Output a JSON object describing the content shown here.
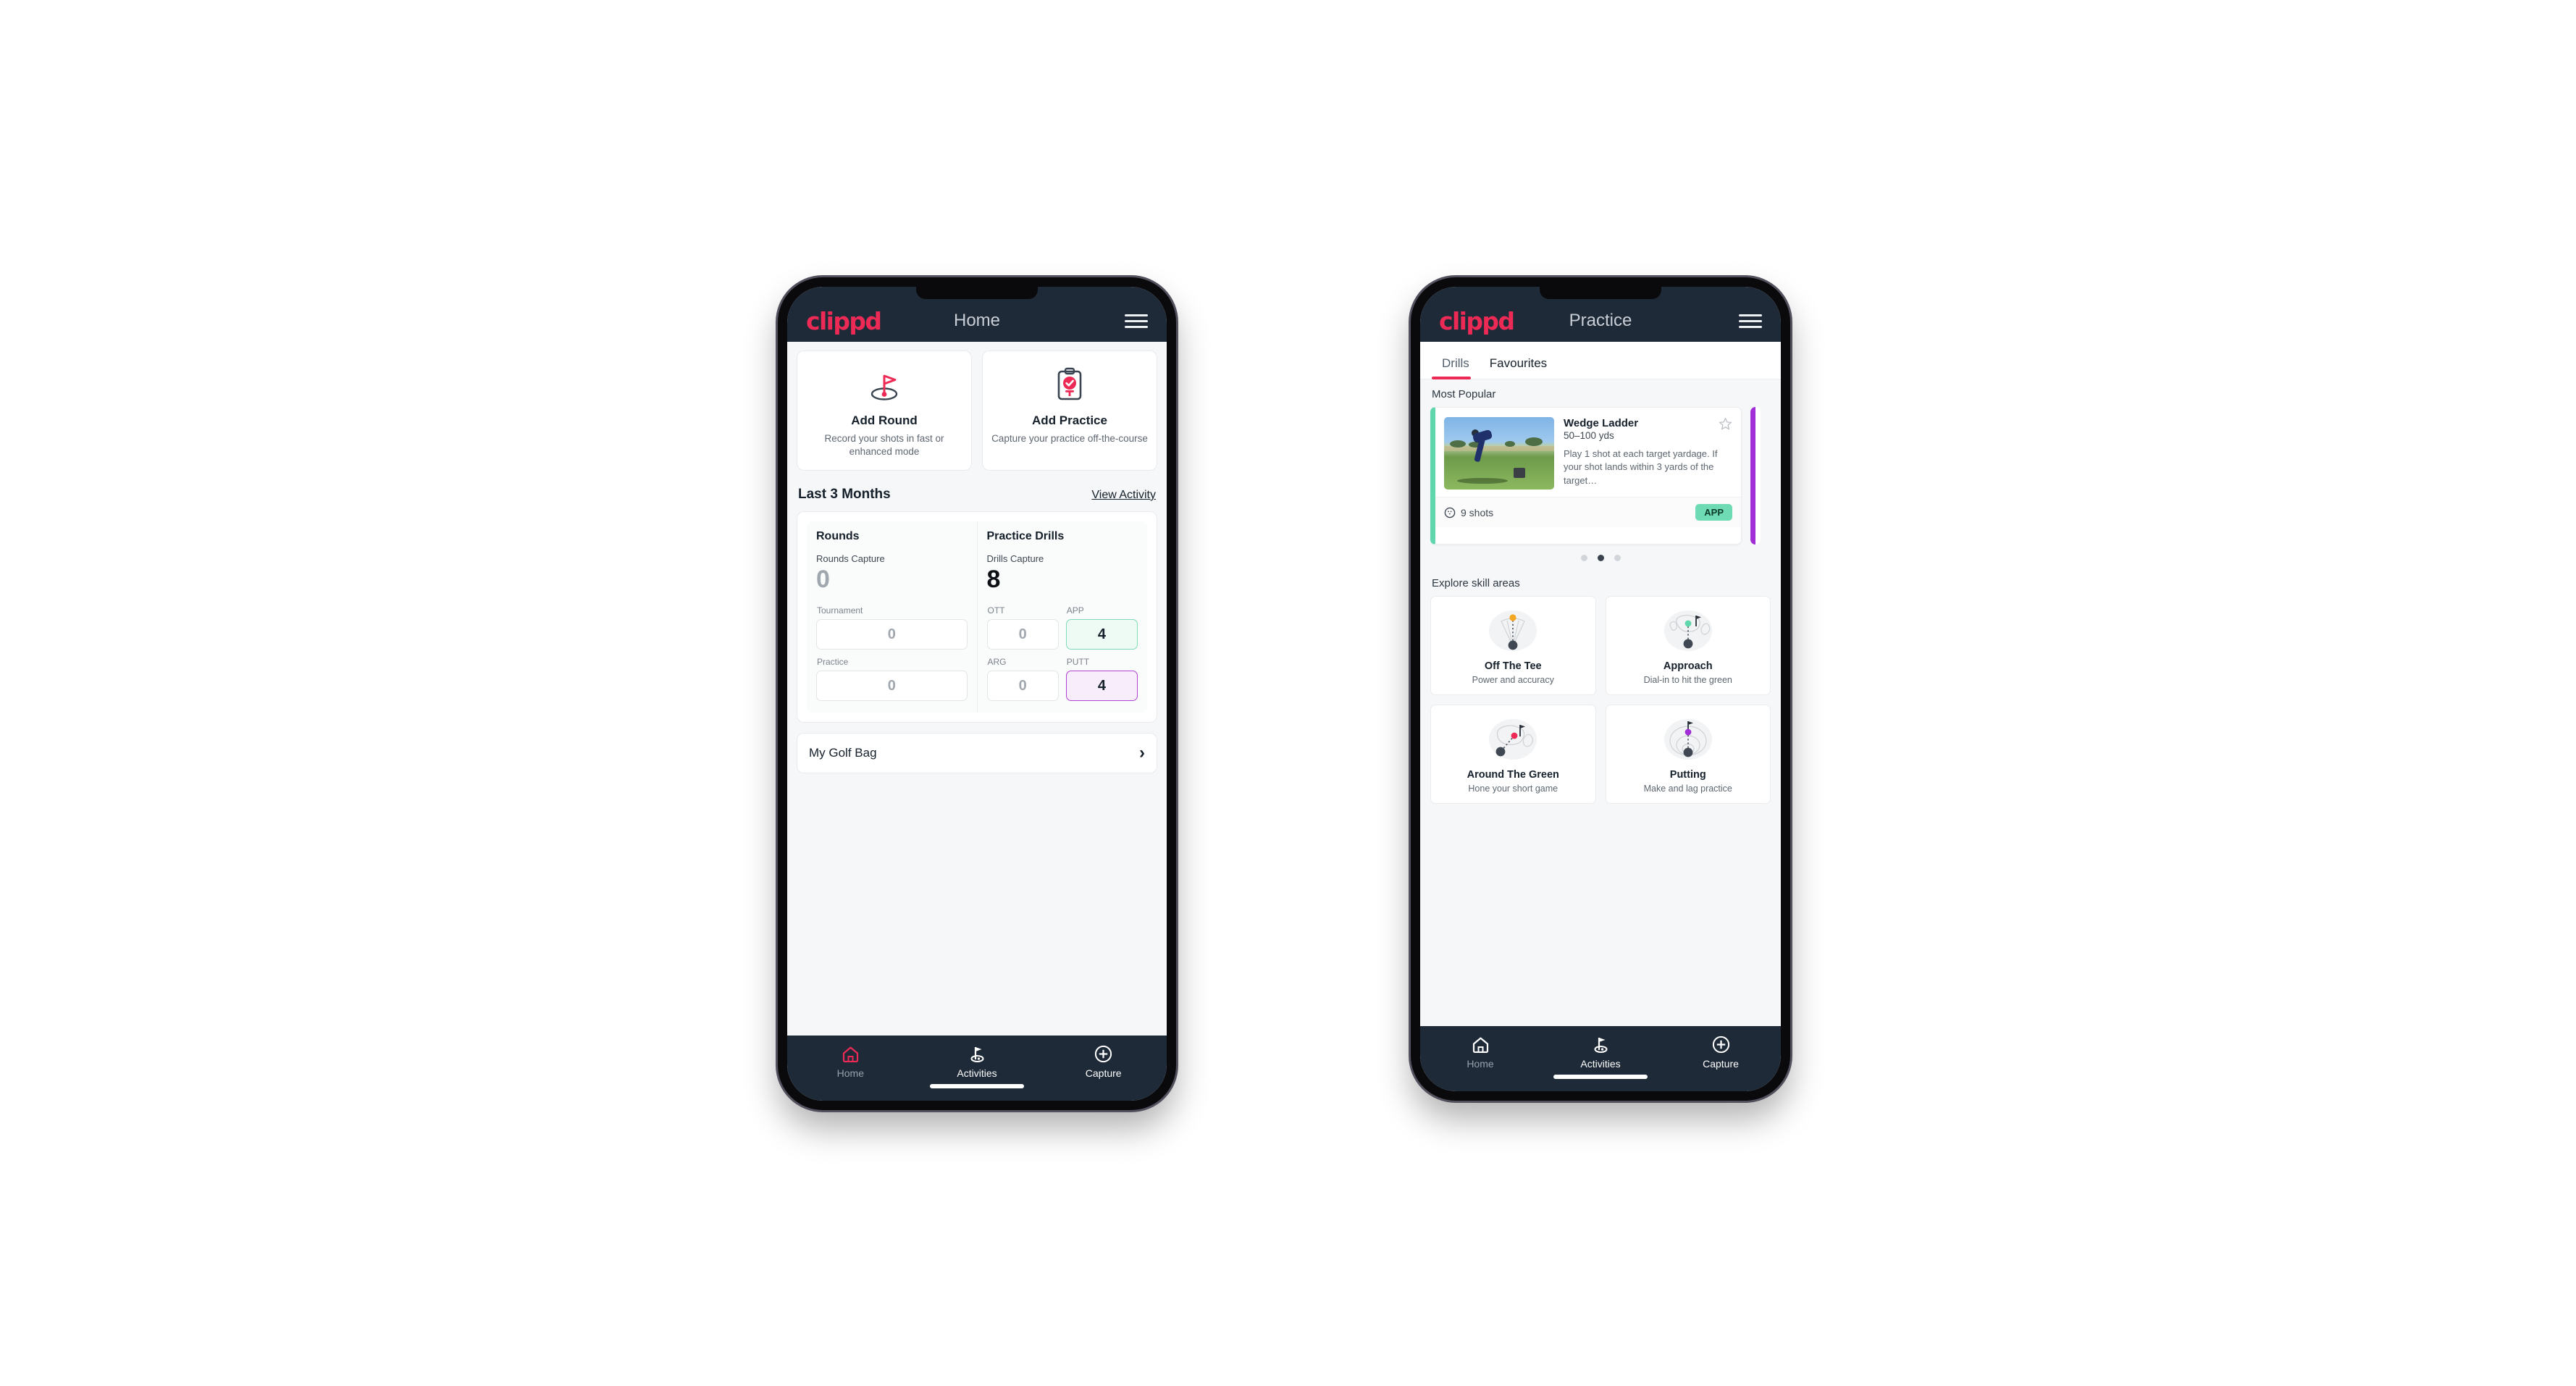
{
  "brand": {
    "logo_text": "clippd",
    "accent": "#ec2a55",
    "appbar_bg": "#1e2a38"
  },
  "phone_home": {
    "appbar": {
      "title": "Home",
      "menu_icon": "hamburger-icon"
    },
    "actions": [
      {
        "icon": "golf-flag-icon",
        "title": "Add Round",
        "subtitle": "Record your shots in fast or enhanced mode"
      },
      {
        "icon": "clipboard-check-icon",
        "title": "Add Practice",
        "subtitle": "Capture your practice off-the-course"
      }
    ],
    "section": {
      "title": "Last 3 Months",
      "link": "View Activity"
    },
    "rounds": {
      "heading": "Rounds",
      "capture_label": "Rounds Capture",
      "capture_value": "0",
      "fields": [
        {
          "label": "Tournament",
          "value": "0",
          "state": "empty"
        },
        {
          "label": "Practice",
          "value": "0",
          "state": "empty"
        }
      ]
    },
    "drills": {
      "heading": "Practice Drills",
      "capture_label": "Drills Capture",
      "capture_value": "8",
      "fields": [
        {
          "label": "OTT",
          "value": "0",
          "state": "empty"
        },
        {
          "label": "APP",
          "value": "4",
          "state": "green"
        },
        {
          "label": "ARG",
          "value": "0",
          "state": "empty"
        },
        {
          "label": "PUTT",
          "value": "4",
          "state": "purple"
        }
      ]
    },
    "golf_bag": {
      "label": "My Golf Bag",
      "chevron": "chevron-right-icon"
    },
    "nav": [
      {
        "icon": "home-icon",
        "label": "Home",
        "active": false
      },
      {
        "icon": "golf-flag-icon",
        "label": "Activities",
        "active": true
      },
      {
        "icon": "plus-circle-icon",
        "label": "Capture",
        "active": false
      }
    ]
  },
  "phone_practice": {
    "appbar": {
      "title": "Practice",
      "menu_icon": "hamburger-icon"
    },
    "tabs": [
      {
        "label": "Drills",
        "active": true
      },
      {
        "label": "Favourites",
        "active": false
      }
    ],
    "most_popular": {
      "title": "Most Popular",
      "card": {
        "name": "Wedge Ladder",
        "yardage": "50–100 yds",
        "description": "Play 1 shot at each target yardage. If your shot lands within 3 yards of the target…",
        "shots": "9 shots",
        "shots_icon": "golf-ball-icon",
        "badge": "APP",
        "badge_color": "#6edbb4",
        "favourite_icon": "star-outline-icon",
        "accent_color": "#5fd6ab",
        "next_accent_color": "#a12ed6"
      },
      "dots": [
        false,
        true,
        false
      ]
    },
    "skills": {
      "title": "Explore skill areas",
      "cards": [
        {
          "icon": "tee-shot-fan-icon",
          "name": "Off The Tee",
          "subtitle": "Power and accuracy",
          "dot_color": "#f5a623"
        },
        {
          "icon": "approach-green-icon",
          "name": "Approach",
          "subtitle": "Dial-in to hit the green",
          "dot_color": "#5fd6ab"
        },
        {
          "icon": "chip-green-icon",
          "name": "Around The Green",
          "subtitle": "Hone your short game",
          "dot_color": "#ec2a55"
        },
        {
          "icon": "putting-rings-icon",
          "name": "Putting",
          "subtitle": "Make and lag practice",
          "dot_color": "#a12ed6"
        }
      ]
    },
    "nav": [
      {
        "icon": "home-icon",
        "label": "Home",
        "active": false
      },
      {
        "icon": "golf-flag-icon",
        "label": "Activities",
        "active": true
      },
      {
        "icon": "plus-circle-icon",
        "label": "Capture",
        "active": false
      }
    ]
  }
}
